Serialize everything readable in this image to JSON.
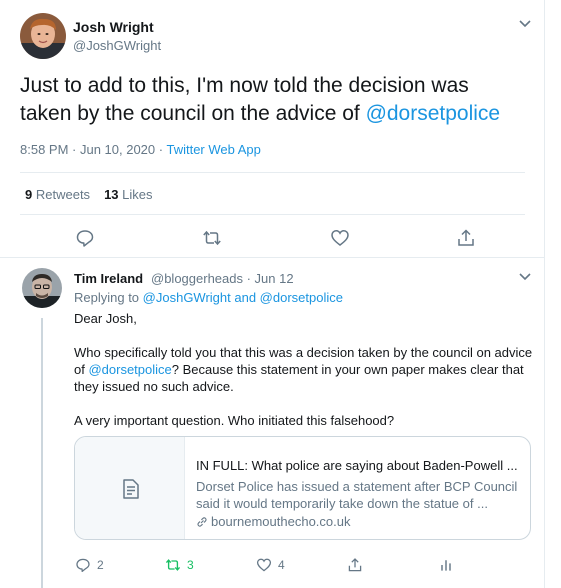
{
  "main_tweet": {
    "author_name": "Josh Wright",
    "author_handle": "@JoshGWright",
    "text_before": "Just to add to this, I'm now told the decision was taken by the council on the advice of ",
    "text_mention": "@dorsetpolice",
    "timestamp": "8:58 PM · Jun 10, 2020 · ",
    "source": "Twitter Web App",
    "retweets_count": "9",
    "retweets_label": "Retweets",
    "likes_count": "13",
    "likes_label": "Likes",
    "icons": [
      "reply-icon",
      "retweet-icon",
      "like-icon",
      "share-icon"
    ]
  },
  "reply_tweet": {
    "author_name": "Tim Ireland",
    "author_handle_time": "@bloggerheads · Jun 12",
    "replying_prefix": "Replying to ",
    "replying_mention1": "@JoshGWright",
    "replying_and": " and ",
    "replying_mention2": "@dorsetpolice",
    "line1": "Dear Josh,",
    "line2_before": "Who specifically told you that this was a decision taken by the council on advice of ",
    "line2_mention": "@dorsetpolice",
    "line2_after": "? Because this statement in your own paper makes clear that they issued no such advice.",
    "line3": "A very important question. Who initiated this falsehood?",
    "card": {
      "title": "IN FULL: What police are saying about Baden-Powell ...",
      "description": "Dorset Police has issued a statement after BCP Council said it would temporarily take down the statue of ...",
      "url": "bournemouthecho.co.uk"
    },
    "reply_count": "2",
    "retweet_count": "3",
    "like_count": "4",
    "colors": {
      "retweeted": "#17bf63",
      "link": "#1b95e0",
      "muted": "#657786"
    }
  }
}
